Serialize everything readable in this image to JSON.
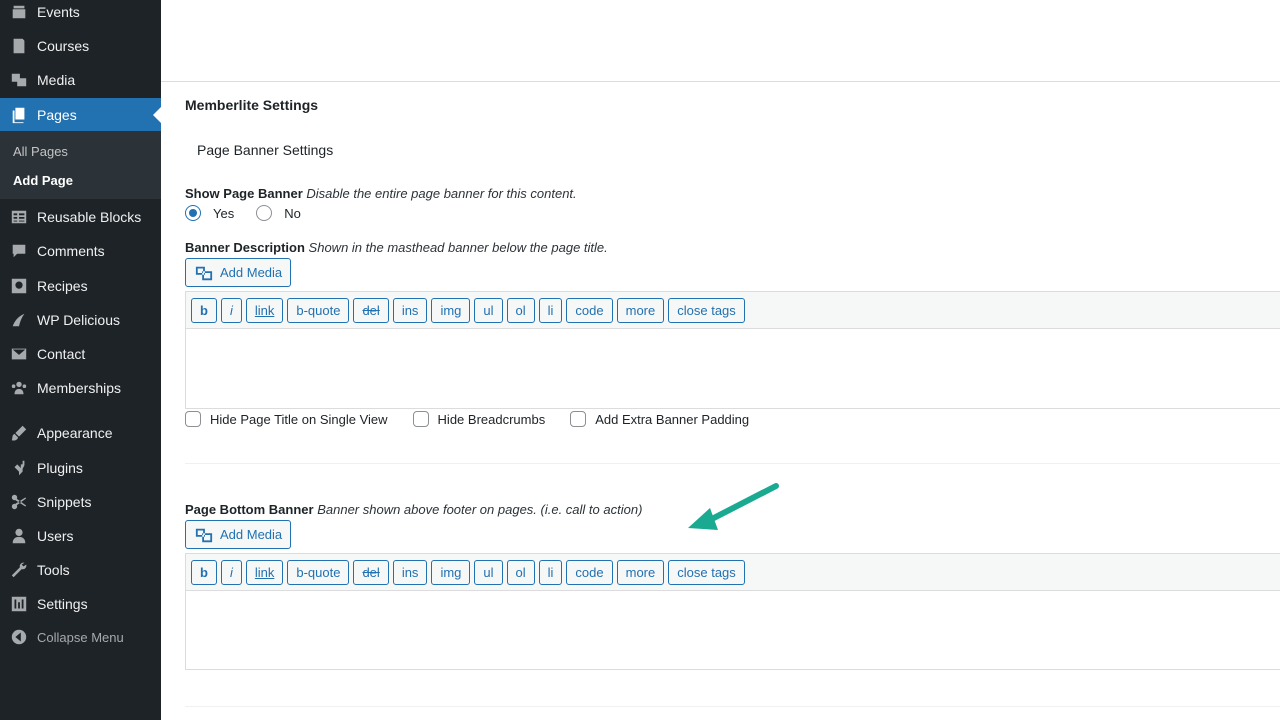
{
  "sidebar": {
    "items": [
      {
        "label": "Events",
        "icon": "calendar-icon"
      },
      {
        "label": "Courses",
        "icon": "book-icon"
      },
      {
        "label": "Media",
        "icon": "media-icon"
      },
      {
        "label": "Pages",
        "icon": "pages-icon",
        "current": true
      },
      {
        "label": "Reusable Blocks",
        "icon": "blocks-icon"
      },
      {
        "label": "Comments",
        "icon": "comment-icon"
      },
      {
        "label": "Recipes",
        "icon": "recipes-icon"
      },
      {
        "label": "WP Delicious",
        "icon": "delicious-icon"
      },
      {
        "label": "Contact",
        "icon": "mail-icon"
      },
      {
        "label": "Memberships",
        "icon": "groups-icon"
      },
      {
        "label": "Appearance",
        "icon": "brush-icon"
      },
      {
        "label": "Plugins",
        "icon": "plug-icon"
      },
      {
        "label": "Snippets",
        "icon": "scissors-icon"
      },
      {
        "label": "Users",
        "icon": "user-icon"
      },
      {
        "label": "Tools",
        "icon": "wrench-icon"
      },
      {
        "label": "Settings",
        "icon": "settings-icon"
      }
    ],
    "submenu": {
      "all_pages": "All Pages",
      "add_page": "Add Page"
    },
    "collapse_label": "Collapse Menu"
  },
  "main": {
    "section_title": "Memberlite Settings",
    "sub_title": "Page Banner Settings",
    "show_banner": {
      "label": "Show Page Banner",
      "desc": "Disable the entire page banner for this content.",
      "yes": "Yes",
      "no": "No",
      "selected": "Yes"
    },
    "banner_description": {
      "label": "Banner Description",
      "desc": "Shown in the masthead banner below the page title."
    },
    "add_media_label": "Add Media",
    "toolbar_buttons": [
      "b",
      "i",
      "link",
      "b-quote",
      "del",
      "ins",
      "img",
      "ul",
      "ol",
      "li",
      "code",
      "more",
      "close tags"
    ],
    "checkboxes": {
      "hide_title": "Hide Page Title on Single View",
      "hide_breadcrumbs": "Hide Breadcrumbs",
      "extra_padding": "Add Extra Banner Padding"
    },
    "bottom_banner": {
      "label": "Page Bottom Banner",
      "desc": "Banner shown above footer on pages. (i.e. call to action)"
    }
  },
  "colors": {
    "sidebar_bg": "#1d2327",
    "accent": "#2271b1",
    "arrow": "#1aaa92"
  }
}
